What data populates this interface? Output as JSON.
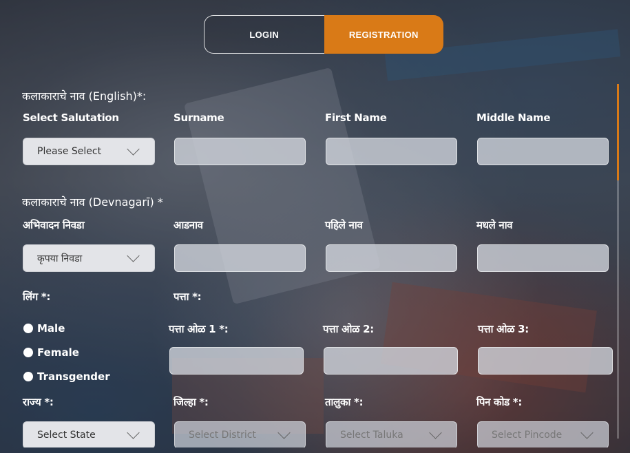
{
  "tabs": {
    "login": "LOGIN",
    "registration": "REGISTRATION"
  },
  "english": {
    "section_title": "कलाकाराचे नाव (English)*:",
    "labels": {
      "salutation": "Select Salutation",
      "surname": "Surname",
      "first": "First Name",
      "middle": "Middle Name"
    },
    "salutation_selected": "Please Select"
  },
  "devnagari": {
    "section_title": "कलाकाराचे नाव (Devnagarī) *",
    "labels": {
      "salutation": "अभिवादन निवडा",
      "surname": "आडनाव",
      "first": "पहिले नाव",
      "middle": "मधले नाव"
    },
    "salutation_selected": "कृपया निवडा"
  },
  "gender": {
    "label": "लिंग *:",
    "options": [
      "Male",
      "Female",
      "Transgender"
    ]
  },
  "address": {
    "label": "पत्ता *:",
    "line1": "पत्ता ओळ 1 *:",
    "line2": "पत्ता ओळ 2:",
    "line3": "पत्ता ओळ 3:"
  },
  "location": {
    "state_label": "राज्य *:",
    "district_label": "जिल्हा *:",
    "taluka_label": "तालुका *:",
    "pincode_label": "पिन कोड *:",
    "state_placeholder": "Select State",
    "district_placeholder": "Select District",
    "taluka_placeholder": "Select Taluka",
    "pincode_placeholder": "Select Pincode"
  },
  "colors": {
    "accent": "#d97a17"
  }
}
